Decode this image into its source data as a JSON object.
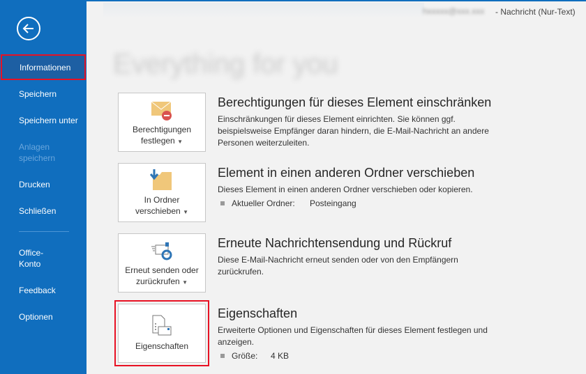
{
  "window": {
    "title_blurred": "hxxxxx@xxx.xxx",
    "title": "-  Nachricht (Nur-Text)"
  },
  "sidebar": {
    "items": [
      {
        "label": "Informationen",
        "selected": true
      },
      {
        "label": "Speichern"
      },
      {
        "label": "Speichern unter"
      },
      {
        "label": "Anlagen speichern",
        "disabled": true
      },
      {
        "label": "Drucken"
      },
      {
        "label": "Schließen"
      },
      {
        "label": "Office-Konto"
      },
      {
        "label": "Feedback"
      },
      {
        "label": "Optionen"
      }
    ]
  },
  "main": {
    "heading": "Everything for you",
    "sections": [
      {
        "button": "Berechtigungen festlegen",
        "title": "Berechtigungen für dieses Element einschränken",
        "desc": "Einschränkungen für dieses Element einrichten. Sie können ggf. beispielsweise Empfänger daran hindern, die E-Mail-Nachricht an andere Personen weiterzuleiten."
      },
      {
        "button": "In Ordner verschieben",
        "title": "Element in einen anderen Ordner verschieben",
        "desc": "Dieses Element in einen anderen Ordner verschieben oder kopieren.",
        "prop_label": "Aktueller Ordner:",
        "prop_value": "Posteingang"
      },
      {
        "button": "Erneut senden oder zurückrufen",
        "title": "Erneute Nachrichtensendung und Rückruf",
        "desc": "Diese E-Mail-Nachricht erneut senden oder von den Empfängern zurückrufen."
      },
      {
        "button": "Eigenschaften",
        "title": "Eigenschaften",
        "desc": "Erweiterte Optionen und Eigenschaften für dieses Element festlegen und anzeigen.",
        "prop_label": "Größe:",
        "prop_value": "4 KB"
      }
    ]
  },
  "colors": {
    "sidebar": "#106ebe",
    "highlight": "#e81123"
  }
}
